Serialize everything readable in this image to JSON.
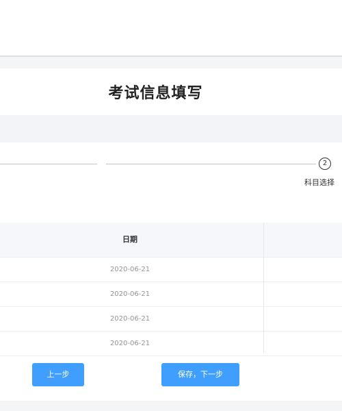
{
  "page": {
    "title": "考试信息填写"
  },
  "steps": {
    "current_label_partial": "",
    "step2_number": "2",
    "step2_label_partial": "科目选择"
  },
  "table": {
    "headers": {
      "date": "日期"
    },
    "rows": [
      {
        "date": "2020-06-21"
      },
      {
        "date": "2020-06-21"
      },
      {
        "date": "2020-06-21"
      },
      {
        "date": "2020-06-21"
      }
    ]
  },
  "buttons": {
    "prev_label": "上一步",
    "next_label": "保存，下一步"
  },
  "colors": {
    "accent": "#409eff",
    "title": "#222222",
    "band": "#f2f4f8"
  }
}
